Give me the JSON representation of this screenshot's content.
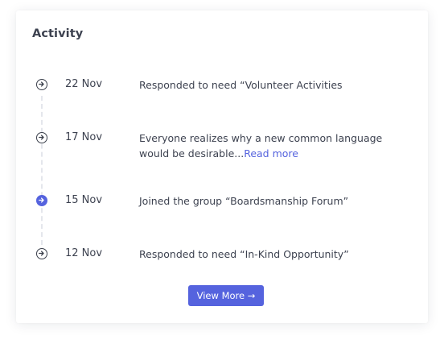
{
  "activity": {
    "title": "Activity",
    "items": [
      {
        "icon": "arrow-circle-icon",
        "date": "22 Nov",
        "text": "Responded to need “Volunteer Activities",
        "link": ""
      },
      {
        "icon": "arrow-circle-icon",
        "date": "17 Nov",
        "text": "Everyone realizes why a new common language would be desirable...",
        "link": "Read more"
      },
      {
        "icon": "arrow-circle-filled-icon",
        "date": "15 Nov",
        "text": "Joined the group “Boardsmanship Forum”",
        "link": ""
      },
      {
        "icon": "arrow-circle-icon",
        "date": "12 Nov",
        "text": "Responded to need “In-Kind Opportunity”",
        "link": ""
      }
    ],
    "view_more_label": "View More →"
  },
  "colors": {
    "accent": "#5563de",
    "text": "#3d4250",
    "background": "#ffffff",
    "timeline": "#e4e6ec"
  }
}
